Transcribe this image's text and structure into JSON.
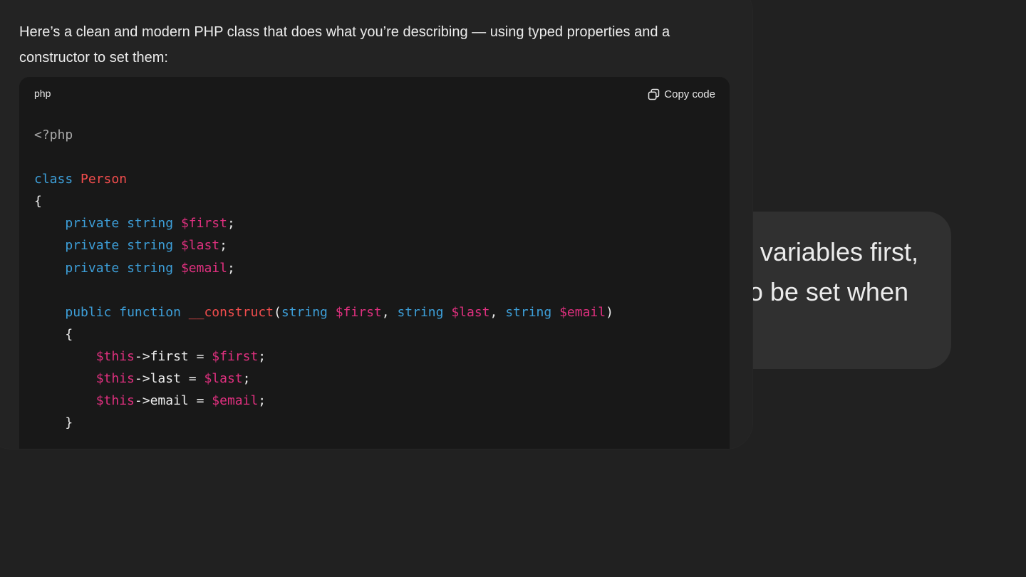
{
  "user_message": {
    "line1": "variables first,",
    "line2": "o be set when"
  },
  "assistant": {
    "intro_text": "Here’s a clean and modern PHP class that does what you’re describing — using typed properties and a constructor to set them:",
    "code_block": {
      "language": "php",
      "copy_label": "Copy code",
      "copy_icon": "copy-icon",
      "lines": [
        [
          {
            "t": "meta",
            "s": "<?php"
          }
        ],
        [],
        [
          {
            "t": "kw",
            "s": "class"
          },
          {
            "t": "pl",
            "s": " "
          },
          {
            "t": "cls",
            "s": "Person"
          }
        ],
        [
          {
            "t": "pl",
            "s": "{"
          }
        ],
        [
          {
            "t": "pl",
            "s": "    "
          },
          {
            "t": "kw",
            "s": "private"
          },
          {
            "t": "pl",
            "s": " "
          },
          {
            "t": "kw",
            "s": "string"
          },
          {
            "t": "pl",
            "s": " "
          },
          {
            "t": "var",
            "s": "$first"
          },
          {
            "t": "pl",
            "s": ";"
          }
        ],
        [
          {
            "t": "pl",
            "s": "    "
          },
          {
            "t": "kw",
            "s": "private"
          },
          {
            "t": "pl",
            "s": " "
          },
          {
            "t": "kw",
            "s": "string"
          },
          {
            "t": "pl",
            "s": " "
          },
          {
            "t": "var",
            "s": "$last"
          },
          {
            "t": "pl",
            "s": ";"
          }
        ],
        [
          {
            "t": "pl",
            "s": "    "
          },
          {
            "t": "kw",
            "s": "private"
          },
          {
            "t": "pl",
            "s": " "
          },
          {
            "t": "kw",
            "s": "string"
          },
          {
            "t": "pl",
            "s": " "
          },
          {
            "t": "var",
            "s": "$email"
          },
          {
            "t": "pl",
            "s": ";"
          }
        ],
        [],
        [
          {
            "t": "pl",
            "s": "    "
          },
          {
            "t": "kw",
            "s": "public"
          },
          {
            "t": "pl",
            "s": " "
          },
          {
            "t": "kw",
            "s": "function"
          },
          {
            "t": "pl",
            "s": " "
          },
          {
            "t": "fn",
            "s": "__construct"
          },
          {
            "t": "pl",
            "s": "("
          },
          {
            "t": "kw",
            "s": "string"
          },
          {
            "t": "pl",
            "s": " "
          },
          {
            "t": "var",
            "s": "$first"
          },
          {
            "t": "pl",
            "s": ", "
          },
          {
            "t": "kw",
            "s": "string"
          },
          {
            "t": "pl",
            "s": " "
          },
          {
            "t": "var",
            "s": "$last"
          },
          {
            "t": "pl",
            "s": ", "
          },
          {
            "t": "kw",
            "s": "string"
          },
          {
            "t": "pl",
            "s": " "
          },
          {
            "t": "var",
            "s": "$email"
          },
          {
            "t": "pl",
            "s": ")"
          }
        ],
        [
          {
            "t": "pl",
            "s": "    {"
          }
        ],
        [
          {
            "t": "pl",
            "s": "        "
          },
          {
            "t": "var",
            "s": "$this"
          },
          {
            "t": "pl",
            "s": "->first = "
          },
          {
            "t": "var",
            "s": "$first"
          },
          {
            "t": "pl",
            "s": ";"
          }
        ],
        [
          {
            "t": "pl",
            "s": "        "
          },
          {
            "t": "var",
            "s": "$this"
          },
          {
            "t": "pl",
            "s": "->last = "
          },
          {
            "t": "var",
            "s": "$last"
          },
          {
            "t": "pl",
            "s": ";"
          }
        ],
        [
          {
            "t": "pl",
            "s": "        "
          },
          {
            "t": "var",
            "s": "$this"
          },
          {
            "t": "pl",
            "s": "->email = "
          },
          {
            "t": "var",
            "s": "$email"
          },
          {
            "t": "pl",
            "s": ";"
          }
        ],
        [
          {
            "t": "pl",
            "s": "    }"
          }
        ]
      ]
    }
  },
  "colors": {
    "background": "#212121",
    "card": "#232323",
    "code_background": "#181818",
    "user_bubble": "#303030",
    "keyword": "#3d9fd9",
    "class_name": "#f24d4d",
    "variable": "#e0307f",
    "meta": "#a8a8a8",
    "text": "#ececec"
  }
}
